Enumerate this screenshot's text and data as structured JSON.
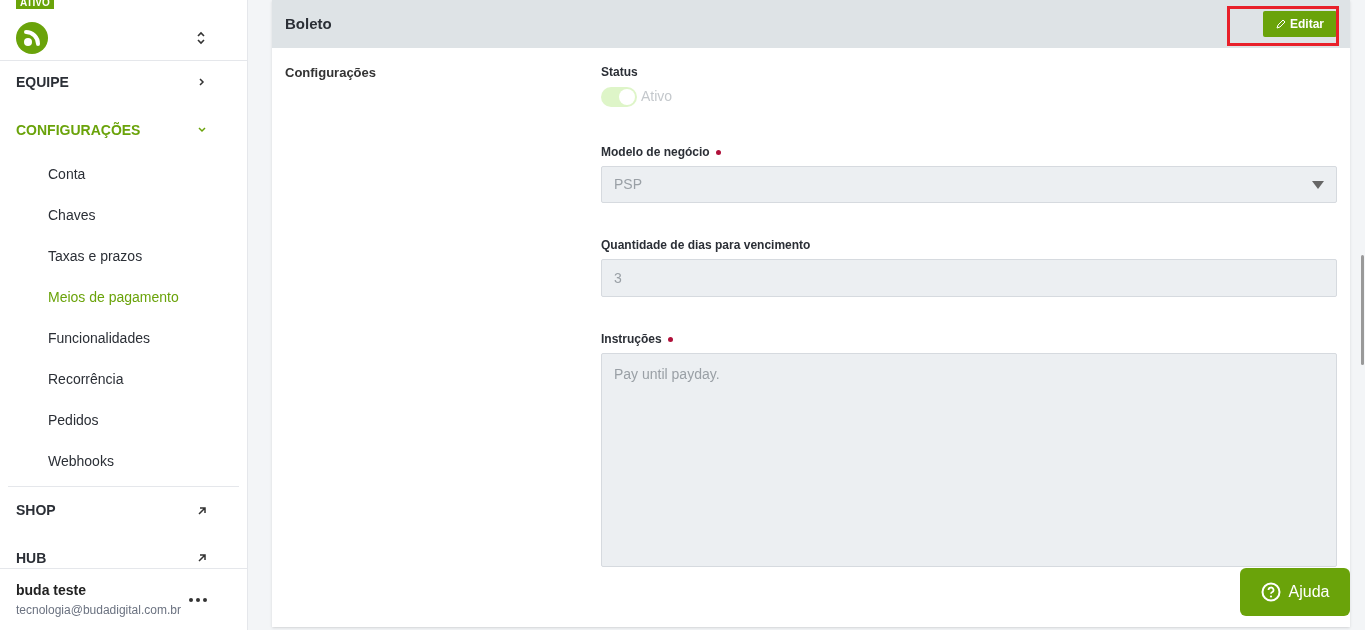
{
  "sidebar": {
    "badge": "ATIVO",
    "items": [
      {
        "label": "EQUIPE",
        "kind": "section",
        "expanded": false,
        "selected": false
      },
      {
        "label": "CONFIGURAÇÕES",
        "kind": "section",
        "expanded": true,
        "selected": true,
        "children": [
          {
            "label": "Conta",
            "selected": false
          },
          {
            "label": "Chaves",
            "selected": false
          },
          {
            "label": "Taxas e prazos",
            "selected": false
          },
          {
            "label": "Meios de pagamento",
            "selected": true
          },
          {
            "label": "Funcionalidades",
            "selected": false
          },
          {
            "label": "Recorrência",
            "selected": false
          },
          {
            "label": "Pedidos",
            "selected": false
          },
          {
            "label": "Webhooks",
            "selected": false
          }
        ]
      },
      {
        "label": "SHOP",
        "kind": "external",
        "selected": false
      },
      {
        "label": "HUB",
        "kind": "external",
        "selected": false
      }
    ],
    "user": {
      "name": "buda teste",
      "email": "tecnologia@budadigital.com.br"
    }
  },
  "card": {
    "title": "Boleto",
    "edit_button": "Editar",
    "section_label": "Configurações",
    "fields": [
      {
        "kind": "toggle",
        "label": "Status",
        "on": true,
        "value": "Ativo",
        "required": false
      },
      {
        "kind": "select",
        "label": "Modelo de negócio",
        "value": "PSP",
        "required": true
      },
      {
        "kind": "input",
        "label": "Quantidade de dias para vencimento",
        "value": "3",
        "required": false
      },
      {
        "kind": "textarea",
        "label": "Instruções",
        "value": "Pay until payday.",
        "required": true
      }
    ]
  },
  "help_button": "Ajuda"
}
